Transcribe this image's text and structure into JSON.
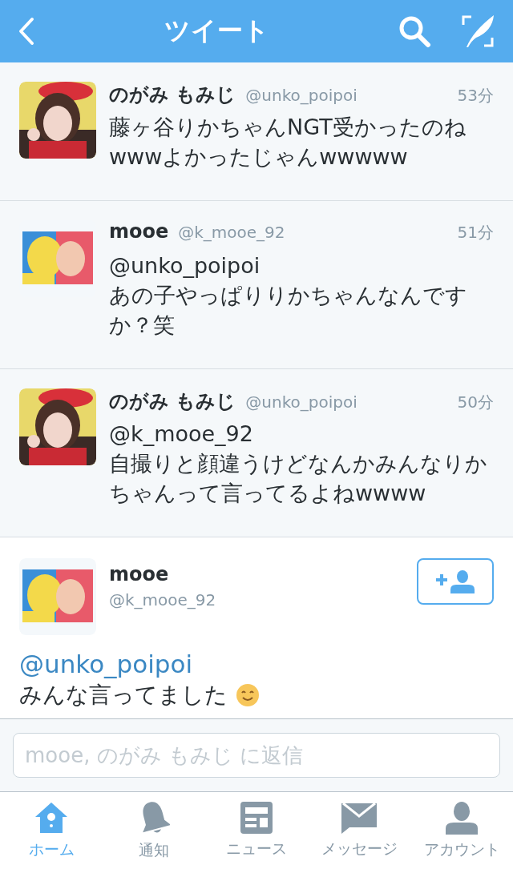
{
  "header": {
    "title": "ツイート"
  },
  "tweets": [
    {
      "name": "のがみ もみじ",
      "handle": "@unko_poipoi",
      "time": "53分",
      "text": "藤ヶ谷りかちゃんNGT受かったのねwwwよかったじゃんwwwww"
    },
    {
      "name": "mooe",
      "handle": "@k_mooe_92",
      "time": "51分",
      "reply_to": "@unko_poipoi",
      "text": "あの子やっぱりりかちゃんなんですか？笑"
    },
    {
      "name": "のがみ もみじ",
      "handle": "@unko_poipoi",
      "time": "50分",
      "reply_to": "@k_mooe_92",
      "text": "自撮りと顔違うけどなんかみんなりかちゃんって言ってるよねwwww"
    }
  ],
  "detail": {
    "name": "mooe",
    "handle": "@k_mooe_92",
    "mention": "@unko_poipoi",
    "text": "みんな言ってました"
  },
  "composer": {
    "placeholder": "mooe, のがみ もみじ に返信"
  },
  "tabs": [
    {
      "label": "ホーム",
      "selected": true
    },
    {
      "label": "通知",
      "selected": false
    },
    {
      "label": "ニュース",
      "selected": false
    },
    {
      "label": "メッセージ",
      "selected": false
    },
    {
      "label": "アカウント",
      "selected": false
    }
  ]
}
